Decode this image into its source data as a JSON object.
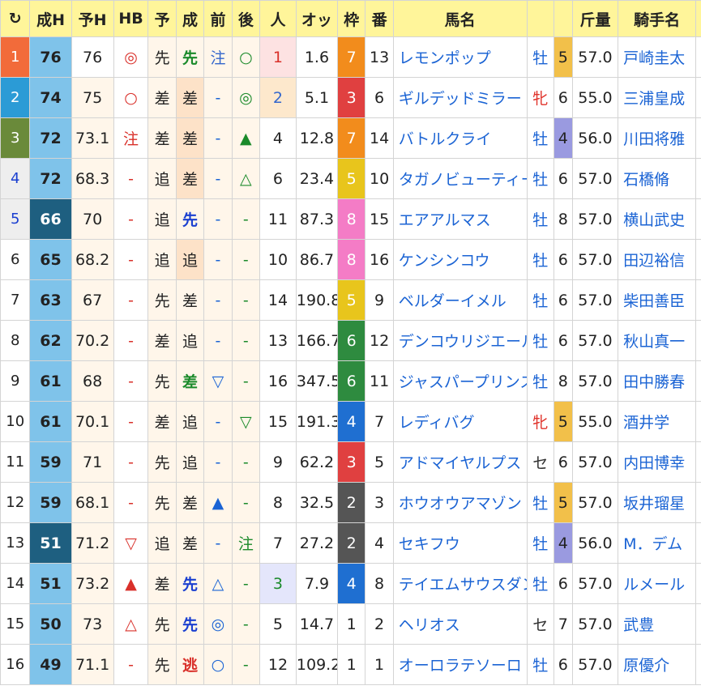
{
  "header": {
    "reload_icon": "↻",
    "seih": "成H",
    "yoh": "予H",
    "hb": "HB",
    "yo": "予",
    "sei": "成",
    "mae": "前",
    "ato": "後",
    "hito": "人",
    "odds": "オッ",
    "waku": "枠",
    "ban": "番",
    "name": "馬名",
    "sex": "",
    "age": "",
    "kinryo": "斤量",
    "jockey": "騎手名"
  },
  "colors": {
    "rank_bg": [
      "#f26b3a",
      "#2b9bd6",
      "#6a8a3a"
    ],
    "waku": {
      "1": "#ffffff",
      "2": "#555555",
      "3": "#e04040",
      "4": "#1f6fd1",
      "5": "#e8c51c",
      "6": "#2e8b3f",
      "7": "#f28c1c",
      "8": "#f47cc6"
    }
  },
  "rows": [
    {
      "rank": "1",
      "seih": "76",
      "yoh": "76",
      "hb": "◎",
      "yo": "先",
      "sei": "先",
      "sei_color": "#1a8a2a",
      "sei_bold": true,
      "mae": "注",
      "ato": "○",
      "ato_color": "#1a8a2a",
      "hito": "1",
      "hito_bg": "#fde2e2",
      "hito_color": "#d9302a",
      "odds": "1.6",
      "waku": "7",
      "ban": "13",
      "name": "レモンポップ",
      "sex": "牡",
      "age": "5",
      "age_bg": "#f2c04a",
      "kinryo": "57.0",
      "jockey": "戸崎圭太"
    },
    {
      "rank": "2",
      "seih": "74",
      "yoh": "75",
      "hb": "○",
      "yo": "差",
      "sei": "差",
      "sei_beige": true,
      "mae": "-",
      "ato": "◎",
      "ato_color": "#1a8a2a",
      "hito": "2",
      "hito_bg": "#fde8cc",
      "hito_color": "#3366cc",
      "odds": "5.1",
      "waku": "3",
      "ban": "6",
      "name": "ギルデッドミラー",
      "sex": "牝",
      "sex_fem": true,
      "age": "6",
      "kinryo": "55.0",
      "jockey": "三浦皇成"
    },
    {
      "rank": "3",
      "seih": "72",
      "yoh": "73.1",
      "hb": "注",
      "yo": "差",
      "sei": "差",
      "sei_beige": true,
      "mae": "-",
      "ato": "▲",
      "ato_color": "#1a8a2a",
      "hito": "4",
      "odds": "12.8",
      "waku": "7",
      "ban": "14",
      "name": "バトルクライ",
      "sex": "牡",
      "age": "4",
      "age_bg": "#9a9ae0",
      "kinryo": "56.0",
      "jockey": "川田将雅"
    },
    {
      "rank": "4",
      "seih": "72",
      "yoh": "68.3",
      "hb": "-",
      "yo": "追",
      "sei": "差",
      "sei_beige": true,
      "mae": "-",
      "ato": "△",
      "ato_color": "#1a8a2a",
      "hito": "6",
      "odds": "23.4",
      "waku": "5",
      "ban": "10",
      "name": "タガノビューティー",
      "sex": "牡",
      "age": "6",
      "kinryo": "57.0",
      "jockey": "石橋脩"
    },
    {
      "rank": "5",
      "seih": "66",
      "yoh": "70",
      "hb": "-",
      "yo": "追",
      "sei": "先",
      "sei_color": "#1a3fd0",
      "sei_bold": true,
      "mae": "-",
      "ato": "-",
      "hito": "11",
      "odds": "87.3",
      "waku": "8",
      "ban": "15",
      "name": "エアアルマス",
      "sex": "牡",
      "age": "8",
      "kinryo": "57.0",
      "jockey": "横山武史"
    },
    {
      "rank": "6",
      "seih": "65",
      "yoh": "68.2",
      "hb": "-",
      "yo": "追",
      "sei": "追",
      "sei_beige": true,
      "mae": "-",
      "ato": "-",
      "hito": "10",
      "odds": "86.7",
      "waku": "8",
      "ban": "16",
      "name": "ケンシンコウ",
      "sex": "牡",
      "age": "6",
      "kinryo": "57.0",
      "jockey": "田辺裕信"
    },
    {
      "rank": "7",
      "seih": "63",
      "yoh": "67",
      "hb": "-",
      "yo": "先",
      "sei": "差",
      "mae": "-",
      "ato": "-",
      "hito": "14",
      "odds": "190.8",
      "waku": "5",
      "ban": "9",
      "name": "ベルダーイメル",
      "sex": "牡",
      "age": "6",
      "kinryo": "57.0",
      "jockey": "柴田善臣"
    },
    {
      "rank": "8",
      "seih": "62",
      "yoh": "70.2",
      "hb": "-",
      "yo": "差",
      "sei": "追",
      "mae": "-",
      "ato": "-",
      "hito": "13",
      "odds": "166.7",
      "waku": "6",
      "ban": "12",
      "name": "デンコウリジエール",
      "sex": "牡",
      "age": "6",
      "kinryo": "57.0",
      "jockey": "秋山真一"
    },
    {
      "rank": "9",
      "seih": "61",
      "yoh": "68",
      "hb": "-",
      "yo": "先",
      "sei": "差",
      "sei_color": "#1a8a2a",
      "sei_bold": true,
      "mae": "▽",
      "ato": "-",
      "hito": "16",
      "odds": "347.5",
      "waku": "6",
      "ban": "11",
      "name": "ジャスパープリンス",
      "sex": "牡",
      "age": "8",
      "kinryo": "57.0",
      "jockey": "田中勝春"
    },
    {
      "rank": "10",
      "seih": "61",
      "yoh": "70.1",
      "hb": "-",
      "yo": "差",
      "sei": "追",
      "mae": "-",
      "ato": "▽",
      "ato_color": "#1a8a2a",
      "hito": "15",
      "odds": "191.3",
      "waku": "4",
      "ban": "7",
      "name": "レディバグ",
      "sex": "牝",
      "sex_fem": true,
      "age": "5",
      "age_bg": "#f2c04a",
      "kinryo": "55.0",
      "jockey": "酒井学"
    },
    {
      "rank": "11",
      "seih": "59",
      "yoh": "71",
      "hb": "-",
      "yo": "先",
      "sei": "追",
      "mae": "-",
      "ato": "-",
      "hito": "9",
      "odds": "62.2",
      "waku": "3",
      "ban": "5",
      "name": "アドマイヤルプス",
      "sex": "セ",
      "sex_gray": true,
      "age": "6",
      "kinryo": "57.0",
      "jockey": "内田博幸"
    },
    {
      "rank": "12",
      "seih": "59",
      "yoh": "68.1",
      "hb": "-",
      "yo": "先",
      "sei": "差",
      "mae": "▲",
      "ato": "-",
      "hito": "8",
      "odds": "32.5",
      "waku": "2",
      "ban": "3",
      "name": "ホウオウアマゾン",
      "sex": "牡",
      "age": "5",
      "age_bg": "#f2c04a",
      "kinryo": "57.0",
      "jockey": "坂井瑠星"
    },
    {
      "rank": "13",
      "seih": "51",
      "yoh": "71.2",
      "hb": "▽",
      "yo": "追",
      "sei": "差",
      "mae": "-",
      "ato": "注",
      "ato_color": "#1a8a2a",
      "hito": "7",
      "odds": "27.2",
      "waku": "2",
      "ban": "4",
      "name": "セキフウ",
      "sex": "牡",
      "age": "4",
      "age_bg": "#9a9ae0",
      "kinryo": "56.0",
      "jockey": "M．デム"
    },
    {
      "rank": "14",
      "seih": "51",
      "yoh": "73.2",
      "hb": "▲",
      "yo": "差",
      "sei": "先",
      "sei_color": "#1a3fd0",
      "sei_bold": true,
      "mae": "△",
      "ato": "-",
      "hito": "3",
      "hito_bg": "#e4e6fb",
      "hito_color": "#1a8a2a",
      "odds": "7.9",
      "waku": "4",
      "ban": "8",
      "name": "テイエムサウスダン",
      "sex": "牡",
      "age": "6",
      "kinryo": "57.0",
      "jockey": "ルメール"
    },
    {
      "rank": "15",
      "seih": "50",
      "yoh": "73",
      "hb": "△",
      "yo": "先",
      "sei": "先",
      "sei_color": "#1a3fd0",
      "sei_bold": true,
      "mae": "◎",
      "ato": "-",
      "hito": "5",
      "odds": "14.7",
      "waku": "1",
      "ban": "2",
      "name": "ヘリオス",
      "sex": "セ",
      "sex_gray": true,
      "age": "7",
      "kinryo": "57.0",
      "jockey": "武豊"
    },
    {
      "rank": "16",
      "seih": "49",
      "yoh": "71.1",
      "hb": "-",
      "yo": "先",
      "sei": "逃",
      "sei_color": "#d9302a",
      "sei_bold": true,
      "mae": "○",
      "ato": "-",
      "hito": "12",
      "odds": "109.2",
      "waku": "1",
      "ban": "1",
      "name": "オーロラテソーロ",
      "sex": "牡",
      "age": "6",
      "kinryo": "57.0",
      "jockey": "原優介"
    }
  ]
}
